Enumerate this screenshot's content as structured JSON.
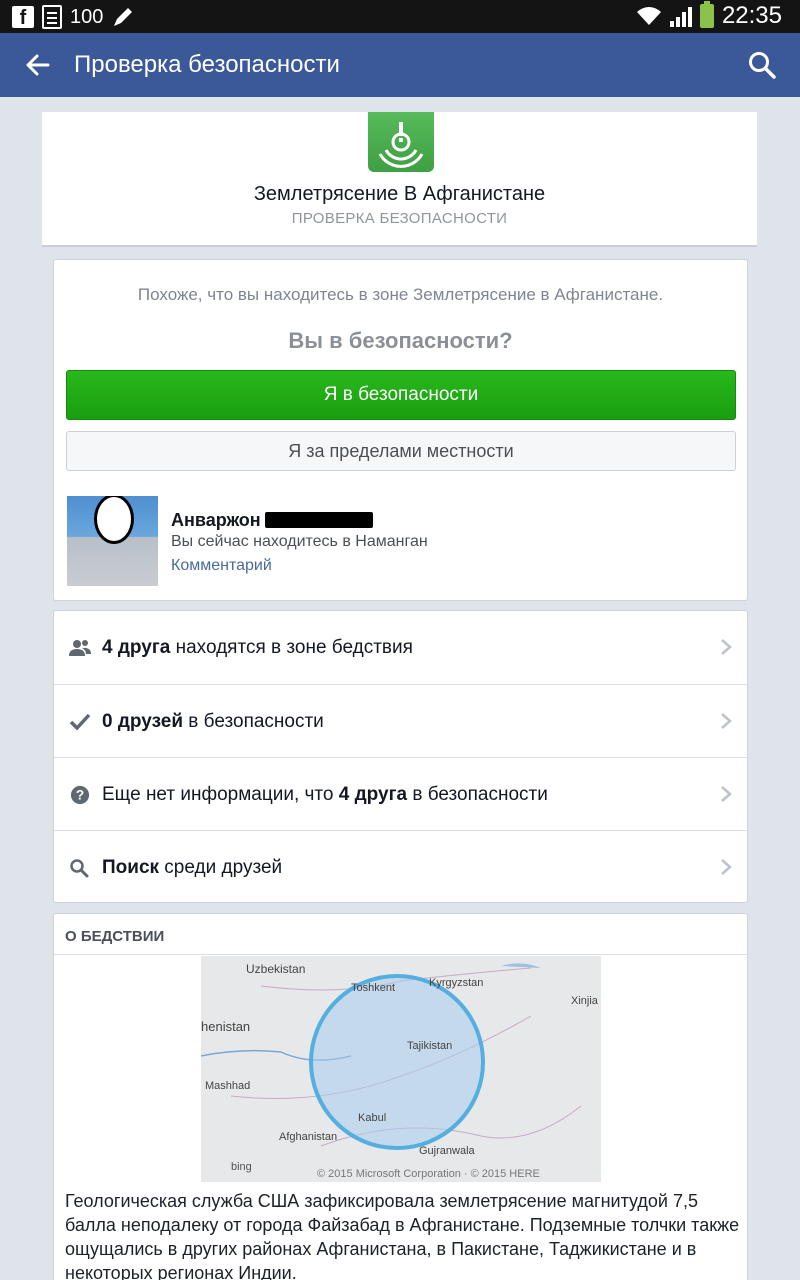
{
  "status_bar": {
    "battery_text": "100",
    "time": "22:35"
  },
  "app_bar": {
    "title": "Проверка безопасности"
  },
  "event": {
    "title": "Землетрясение В Афганистане",
    "subtitle": "ПРОВЕРКА БЕЗОПАСНОСТИ"
  },
  "safety_check": {
    "zone_text": "Похоже, что вы находитесь в зоне Землетрясение в Афганистане.",
    "question": "Вы в безопасности?",
    "safe_button": "Я в безопасности",
    "outside_button": "Я за пределами местности"
  },
  "user": {
    "name": "Анваржон",
    "location": "Вы сейчас находитесь в Наманган",
    "comment_link": "Комментарий"
  },
  "friend_rows": [
    {
      "icon": "friends-icon",
      "bold": "4 друга",
      "rest": " находятся в зоне бедствия"
    },
    {
      "icon": "checkmark-icon",
      "bold": "0 друзей",
      "rest": " в безопасности"
    },
    {
      "icon": "question-icon",
      "pre": "Еще нет информации, что ",
      "bold": "4 друга",
      "rest": " в безопасности"
    },
    {
      "icon": "search-icon",
      "bold": "Поиск",
      "rest": " среди друзей"
    }
  ],
  "about": {
    "title": "О БЕДСТВИИ",
    "map_labels": [
      "Uzbekistan",
      "Kyrgyzstan",
      "Toshkent",
      "Xinjia",
      "henistan",
      "Tajikistan",
      "Mashhad",
      "Kabul",
      "Afghanistan",
      "Gujranwala",
      "bing",
      "© 2015 Microsoft Corporation · © 2015 HERE"
    ],
    "description": "Геологическая служба США зафиксировала землетрясение магнитудой 7,5 балла неподалеку от города Файзабад в Афганистане. Подземные толчки также ощущались в других районах Афганистана, в Пакистане, Таджикистане и в некоторых регионах Индии."
  },
  "colors": {
    "brand": "#3b5998",
    "safe": "#20a614"
  }
}
